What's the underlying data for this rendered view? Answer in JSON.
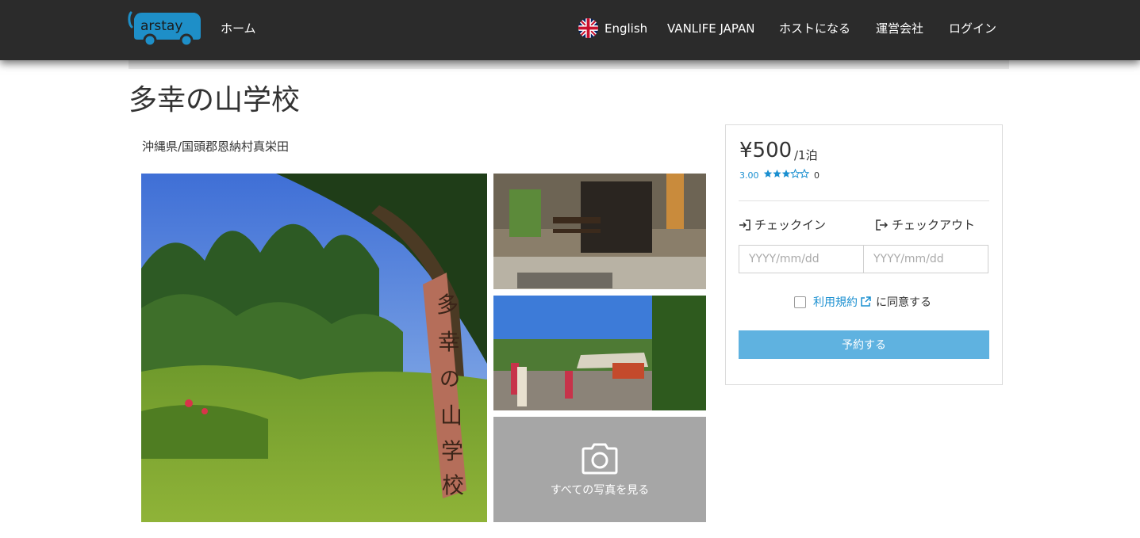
{
  "header": {
    "logo_alt": "Carstay",
    "logo_text": "arstay",
    "nav": {
      "home": "ホーム",
      "language": "English",
      "vanlife": "VANLIFE JAPAN",
      "become_host": "ホストになる",
      "company": "運営会社",
      "login": "ログイン"
    }
  },
  "listing": {
    "title": "多幸の山学校",
    "address": "沖縄県/国頭郡恩納村真栄田",
    "view_all_photos": "すべての写真を見る"
  },
  "booking": {
    "price": "¥500",
    "per_night": "/1泊",
    "rating": "3.00",
    "stars_filled": 3,
    "stars_total": 5,
    "review_count": "0",
    "checkin_label": "チェックイン",
    "checkout_label": "チェックアウト",
    "date_placeholder": "YYYY/mm/dd",
    "terms_link": "利用規約",
    "agree_suffix": "に同意する",
    "agree_checked": false,
    "submit": "予約する"
  },
  "colors": {
    "navbar": "#2b2b2b",
    "logo": "#1e8fc8",
    "link": "#1a8fd0",
    "button": "#5fb2e0",
    "photo_overlay": "#a6a6a6"
  }
}
